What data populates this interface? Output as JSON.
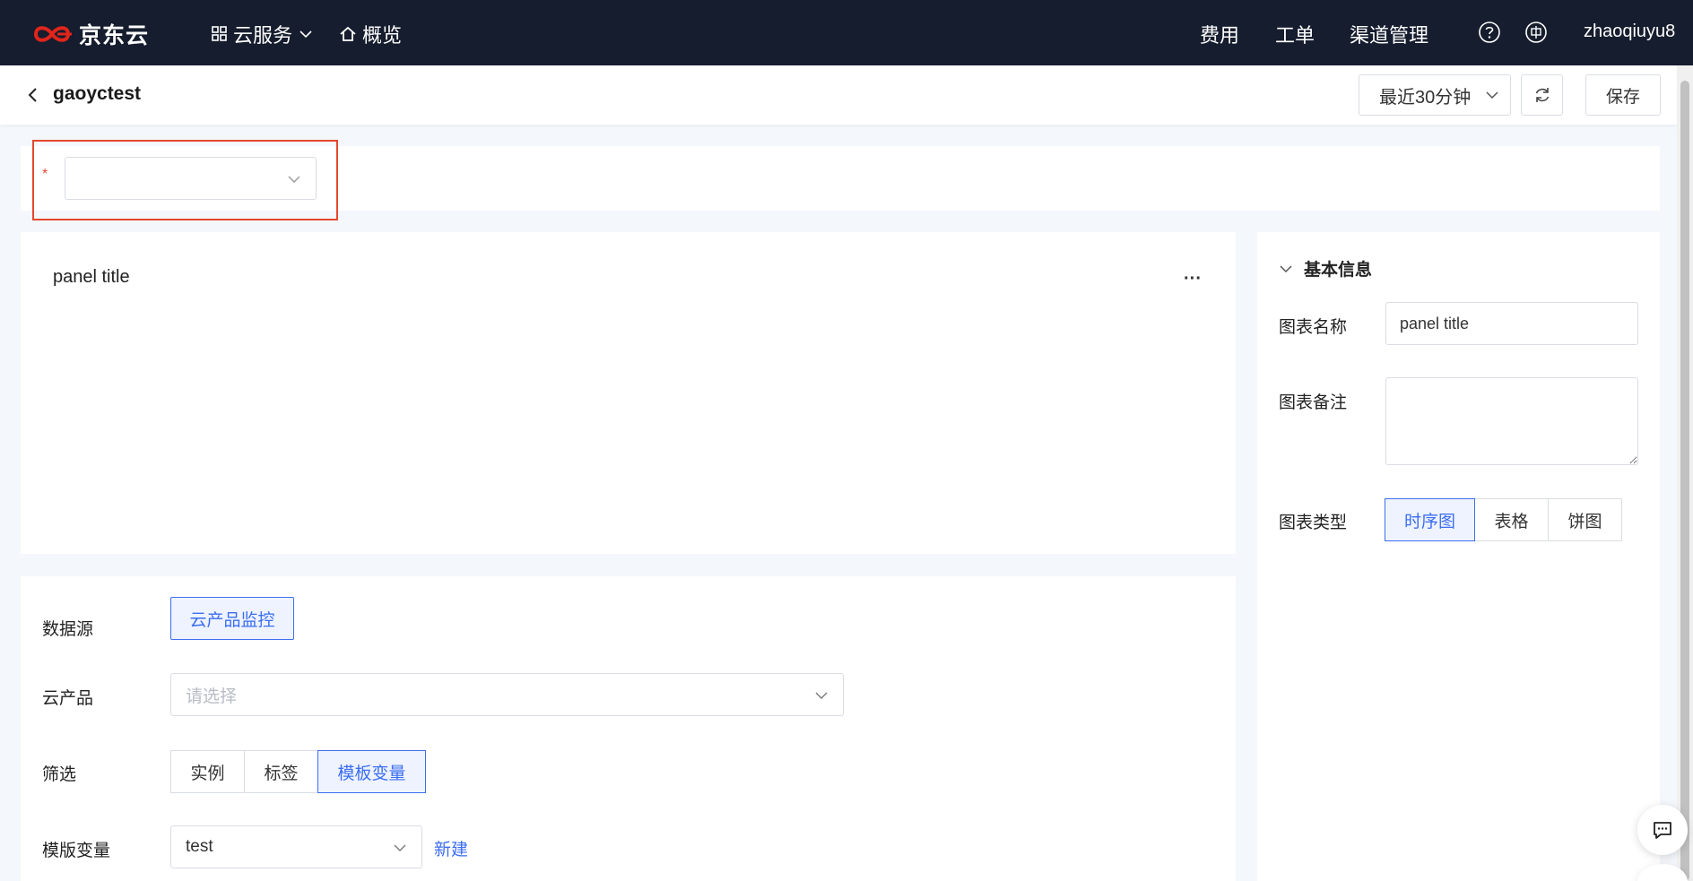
{
  "topnav": {
    "brand": "京东云",
    "cloud_services": "云服务",
    "overview": "概览",
    "fees": "费用",
    "tickets": "工单",
    "channel_mgmt": "渠道管理",
    "username": "zhaoqiuyu8",
    "bg_color": "#161d2e",
    "logo_color": "#e1251b"
  },
  "header": {
    "title": "gaoyctest",
    "time_range": "最近30分钟",
    "save_label": "保存"
  },
  "variable_bar": {
    "required_mark": "*",
    "value": ""
  },
  "panel": {
    "title": "panel title",
    "more": "···"
  },
  "query": {
    "datasource_label": "数据源",
    "datasource_value": "云产品监控",
    "product_label": "云产品",
    "product_placeholder": "请选择",
    "filter_label": "筛选",
    "filter_options": [
      "实例",
      "标签",
      "模板变量"
    ],
    "filter_selected": "模板变量",
    "template_label": "模版变量",
    "template_value": "test",
    "new_link": "新建"
  },
  "side": {
    "section_title": "基本信息",
    "chart_name_label": "图表名称",
    "chart_name_value": "panel title",
    "chart_note_label": "图表备注",
    "chart_type_label": "图表类型",
    "chart_types": [
      "时序图",
      "表格",
      "饼图"
    ],
    "chart_type_selected": "时序图"
  },
  "colors": {
    "accent": "#3c6ef0",
    "highlight": "#e5482d"
  }
}
